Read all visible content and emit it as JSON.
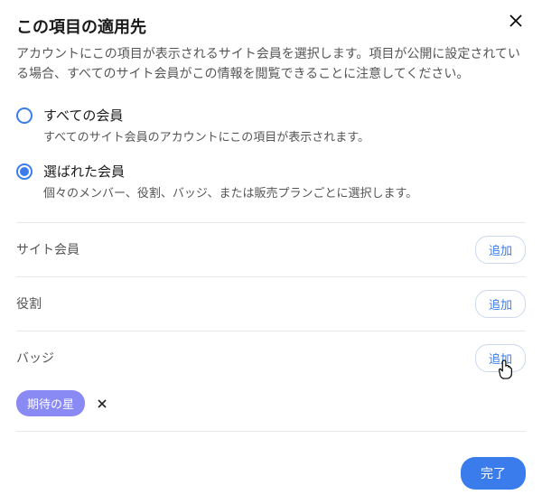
{
  "header": {
    "title": "この項目の適用先",
    "description": "アカウントにこの項目が表示されるサイト会員を選択します。項目が公開に設定されている場合、すべてのサイト会員がこの情報を閲覧できることに注意してください。"
  },
  "options": {
    "all": {
      "label": "すべての会員",
      "description": "すべてのサイト会員のアカウントにこの項目が表示されます。"
    },
    "selected": {
      "label": "選ばれた会員",
      "description": "個々のメンバー、役割、バッジ、または販売プランごとに選択します。"
    }
  },
  "sections": {
    "site_members": {
      "label": "サイト会員",
      "add": "追加"
    },
    "roles": {
      "label": "役割",
      "add": "追加"
    },
    "badges": {
      "label": "バッジ",
      "add": "追加"
    }
  },
  "badges": {
    "items": [
      {
        "label": "期待の星"
      }
    ]
  },
  "footer": {
    "done": "完了"
  }
}
